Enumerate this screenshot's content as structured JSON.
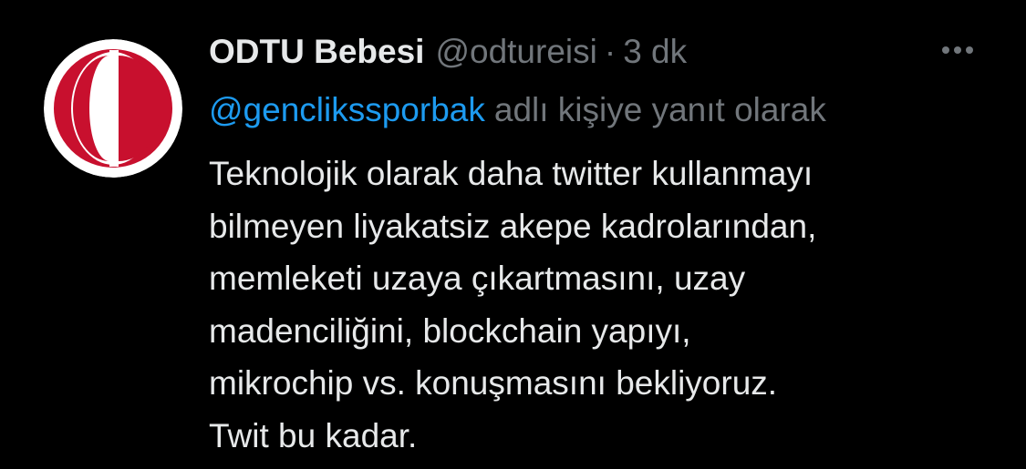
{
  "tweet": {
    "display_name": "ODTU Bebesi",
    "handle": "@odtureisi",
    "separator": "·",
    "time": "3 dk",
    "reply_to": {
      "mention": "@genclikssporbak",
      "suffix": "adlı kişiye yanıt olarak"
    },
    "text_lines": [
      "Teknolojik olarak daha twitter kullanmayı",
      "bilmeyen liyakatsiz akepe kadrolarından,",
      "memleketi uzaya çıkartmasını, uzay",
      "madenciliğini, blockchain yapıyı,",
      "mikrochip vs. konuşmasını bekliyoruz.",
      "Twit bu kadar."
    ],
    "more_icon": "more-horizontal-icon",
    "avatar_icon": "odtu-logo"
  },
  "colors": {
    "background": "#000000",
    "text_primary": "#e7e9ea",
    "text_secondary": "#71767b",
    "accent": "#1d9bf0",
    "logo_red": "#c8102e"
  }
}
